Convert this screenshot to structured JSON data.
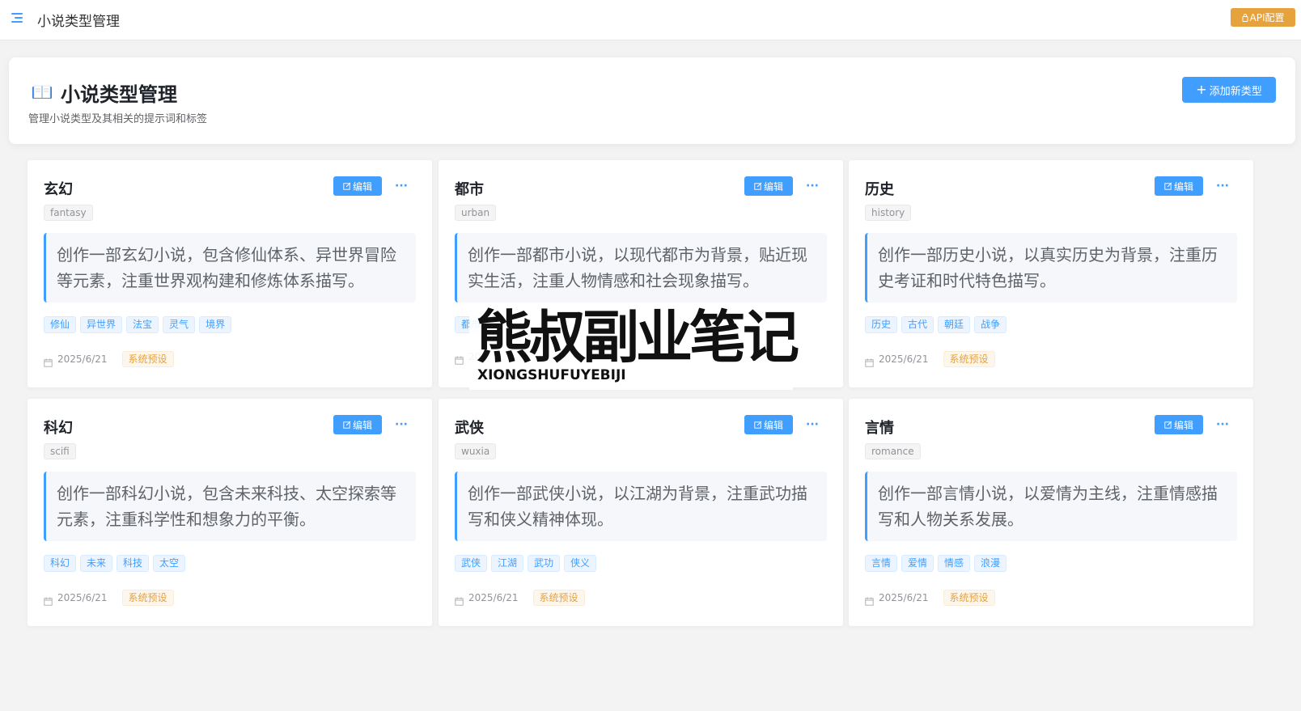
{
  "topbar": {
    "title": "小说类型管理",
    "api_button": "API配置"
  },
  "header": {
    "title": "小说类型管理",
    "subtitle": "管理小说类型及其相关的提示词和标签",
    "add_button": "添加新类型"
  },
  "cards": [
    {
      "name": "玄幻",
      "key": "fantasy",
      "prompt": "创作一部玄幻小说，包含修仙体系、异世界冒险等元素，注重世界观构建和修炼体系描写。",
      "tags": [
        "修仙",
        "异世界",
        "法宝",
        "灵气",
        "境界"
      ],
      "date": "2025/6/21",
      "source": "系统预设",
      "edit_label": "编辑"
    },
    {
      "name": "都市",
      "key": "urban",
      "prompt": "创作一部都市小说，以现代都市为背景，贴近现实生活，注重人物情感和社会现象描写。",
      "tags": [
        "都市"
      ],
      "date": "20",
      "source": "",
      "edit_label": "编辑"
    },
    {
      "name": "历史",
      "key": "history",
      "prompt": "创作一部历史小说，以真实历史为背景，注重历史考证和时代特色描写。",
      "tags": [
        "历史",
        "古代",
        "朝廷",
        "战争"
      ],
      "date": "2025/6/21",
      "source": "系统预设",
      "edit_label": "编辑"
    },
    {
      "name": "科幻",
      "key": "scifi",
      "prompt": "创作一部科幻小说，包含未来科技、太空探索等元素，注重科学性和想象力的平衡。",
      "tags": [
        "科幻",
        "未来",
        "科技",
        "太空"
      ],
      "date": "2025/6/21",
      "source": "系统预设",
      "edit_label": "编辑"
    },
    {
      "name": "武侠",
      "key": "wuxia",
      "prompt": "创作一部武侠小说，以江湖为背景，注重武功描写和侠义精神体现。",
      "tags": [
        "武侠",
        "江湖",
        "武功",
        "侠义"
      ],
      "date": "2025/6/21",
      "source": "系统预设",
      "edit_label": "编辑"
    },
    {
      "name": "言情",
      "key": "romance",
      "prompt": "创作一部言情小说，以爱情为主线，注重情感描写和人物关系发展。",
      "tags": [
        "言情",
        "爱情",
        "情感",
        "浪漫"
      ],
      "date": "2025/6/21",
      "source": "系统预设",
      "edit_label": "编辑"
    }
  ],
  "more_label": "···",
  "watermark": {
    "main": "熊叔副业笔记",
    "sub": "XIONGSHUFUYEBIJI"
  },
  "colors": {
    "primary": "#409eff",
    "warning": "#e6a23c",
    "background": "#f3f3f4"
  },
  "icons": {
    "menu": "menu-fold-icon",
    "api": "lock-icon",
    "add": "plus-icon",
    "book": "open-book-icon",
    "edit": "edit-icon",
    "date": "calendar-icon"
  }
}
